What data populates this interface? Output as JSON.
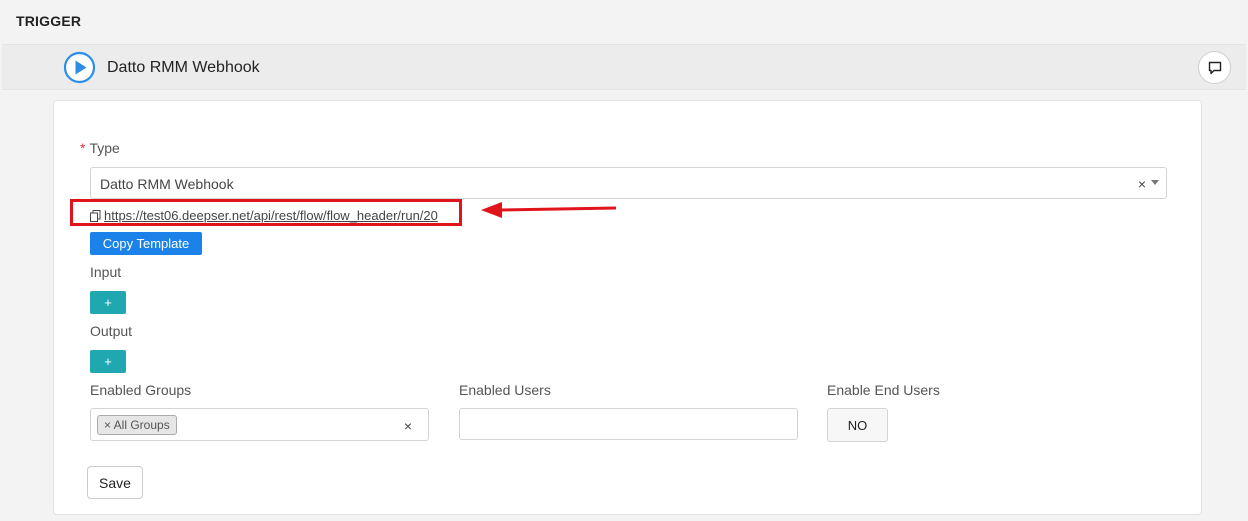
{
  "section_title": "TRIGGER",
  "trigger": {
    "name": "Datto RMM Webhook",
    "icon": "play-circle-icon",
    "comment_icon": "comment-icon"
  },
  "form": {
    "type_label": "Type",
    "type_required_mark": "*",
    "type_value": "Datto RMM Webhook",
    "type_clear": "×",
    "webhook_url": "https://test06.deepser.net/api/rest/flow/flow_header/run/20",
    "copy_icon": "copy-icon",
    "copy_template_label": "Copy Template",
    "input_label": "Input",
    "input_add_label": "+",
    "output_label": "Output",
    "output_add_label": "+",
    "enabled_groups_label": "Enabled Groups",
    "enabled_groups_chip": "× All Groups",
    "enabled_groups_clear": "×",
    "enabled_users_label": "Enabled Users",
    "enabled_users_value": "",
    "enable_end_users_label": "Enable End Users",
    "enable_end_users_value": "NO",
    "save_label": "Save"
  },
  "annotation": {
    "highlight_color": "#e0151c"
  },
  "colors": {
    "primary": "#1a82e8",
    "teal": "#1fa8b0",
    "play": "#2d8de6"
  }
}
